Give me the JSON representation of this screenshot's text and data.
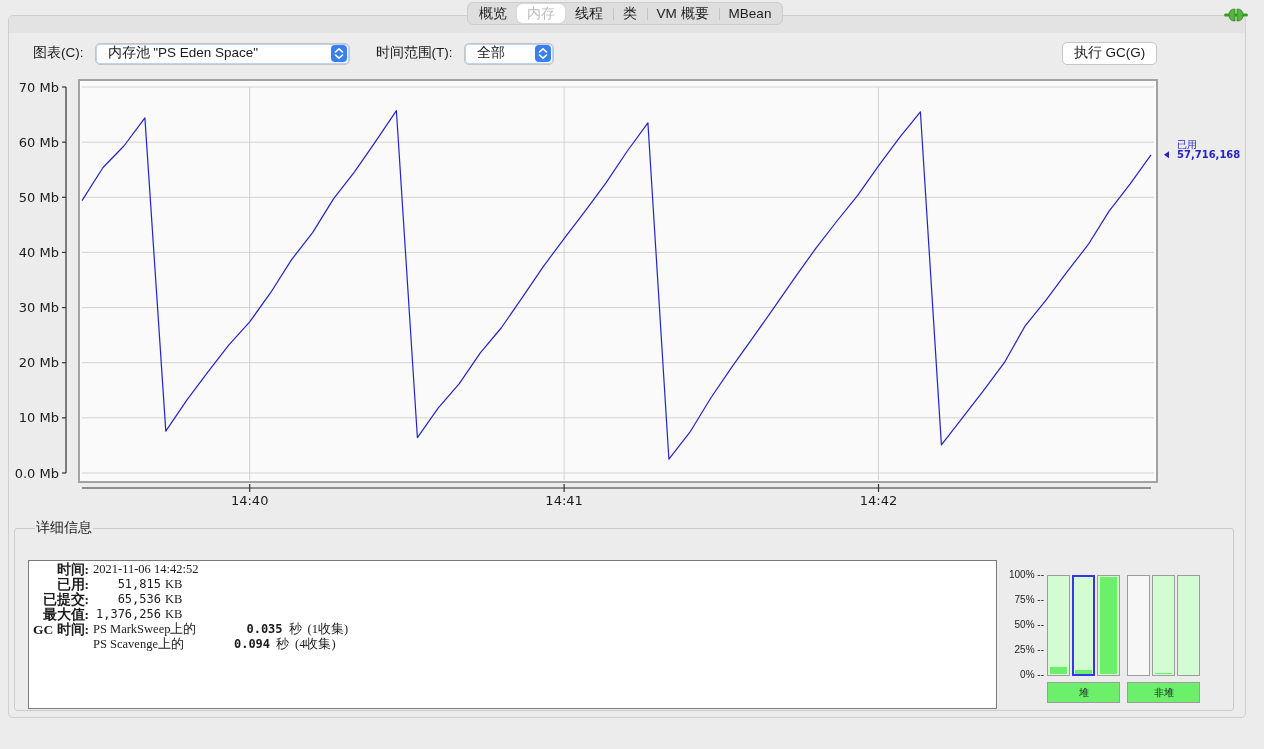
{
  "tabs": [
    {
      "label": "概览",
      "selected": false
    },
    {
      "label": "内存",
      "selected": true
    },
    {
      "label": "线程",
      "selected": false
    },
    {
      "label": "类",
      "selected": false
    },
    {
      "label": "VM 概要",
      "selected": false
    },
    {
      "label": "MBean",
      "selected": false
    }
  ],
  "toolbar": {
    "chart_label": "图表(C):",
    "chart_select": "内存池 \"PS Eden Space\"",
    "range_label": "时间范围(T):",
    "range_select": "全部",
    "gc_button": "执行 GC(G)"
  },
  "chart": {
    "current_reading": "57,716,168",
    "chart_data": {
      "type": "line",
      "grid": true,
      "categories": [
        null,
        null,
        null,
        null,
        null,
        null,
        null,
        null,
        "14:40",
        null,
        null,
        null,
        null,
        null,
        null,
        null,
        null,
        null,
        null,
        null,
        null,
        null,
        null,
        "14:41",
        null,
        null,
        null,
        null,
        null,
        null,
        null,
        null,
        null,
        null,
        null,
        null,
        null,
        null,
        "14:42",
        null,
        null,
        null,
        null,
        null,
        null,
        null,
        null,
        null,
        null,
        null,
        null,
        null
      ],
      "series": [
        {
          "name": "已用",
          "color": "#2323c8",
          "values": [
            49.4,
            55.4,
            59.3,
            64.4,
            7.6,
            13.2,
            18.3,
            23.2,
            27.4,
            32.7,
            38.7,
            43.6,
            49.7,
            54.6,
            60.1,
            65.7,
            6.4,
            11.8,
            16.2,
            21.8,
            26.3,
            31.8,
            37.4,
            42.5,
            47.5,
            52.6,
            58.3,
            63.5,
            2.5,
            7.4,
            13.6,
            19.2,
            24.5,
            29.9,
            35.4,
            40.7,
            45.6,
            50.3,
            55.7,
            60.8,
            65.5,
            5.1,
            10.0,
            14.9,
            20.0,
            26.7,
            31.4,
            36.5,
            41.4,
            47.5,
            52.4,
            57.7
          ]
        }
      ],
      "ylim": [
        0,
        70
      ],
      "yticks": [
        {
          "value": 0,
          "label": "0.0 Mb"
        },
        {
          "value": 10,
          "label": "10 Mb"
        },
        {
          "value": 20,
          "label": "20 Mb"
        },
        {
          "value": 30,
          "label": "30 Mb"
        },
        {
          "value": 40,
          "label": "40 Mb"
        },
        {
          "value": 50,
          "label": "50 Mb"
        },
        {
          "value": 60,
          "label": "60 Mb"
        },
        {
          "value": 70,
          "label": "70 Mb"
        }
      ]
    }
  },
  "details": {
    "title": "详细信息",
    "rows": [
      {
        "label": "时间:",
        "value": "2021-11-06 14:42:52"
      },
      {
        "label": "已用:",
        "value": "51,815",
        "unit": "KB"
      },
      {
        "label": "已提交:",
        "value": "65,536",
        "unit": "KB"
      },
      {
        "label": "最大值:",
        "value": "1,376,256",
        "unit": "KB"
      }
    ],
    "gc": {
      "label": "GC 时间:",
      "rows": [
        {
          "collector": "PS MarkSweep上的",
          "time": "0.035",
          "unit": "秒",
          "count": "(1收集)"
        },
        {
          "collector": "PS Scavenge上的",
          "time": "0.094",
          "unit": "秒",
          "count": "(4收集)"
        }
      ]
    }
  },
  "meters": {
    "scale": [
      "100% --",
      "75% --",
      "50% --",
      "25% --",
      "0% --"
    ],
    "groups": [
      {
        "label": "堆",
        "bars": [
          {
            "kind": "bounded",
            "selected": false,
            "level": 0.07
          },
          {
            "kind": "bounded",
            "selected": true,
            "level": 0.04
          },
          {
            "kind": "bounded",
            "selected": false,
            "level": 1
          }
        ]
      },
      {
        "label": "非堆",
        "bars": [
          {
            "kind": "unbounded",
            "selected": false
          },
          {
            "kind": "bounded",
            "selected": false,
            "level": 0.01
          },
          {
            "kind": "bounded",
            "selected": false
          }
        ]
      }
    ]
  }
}
